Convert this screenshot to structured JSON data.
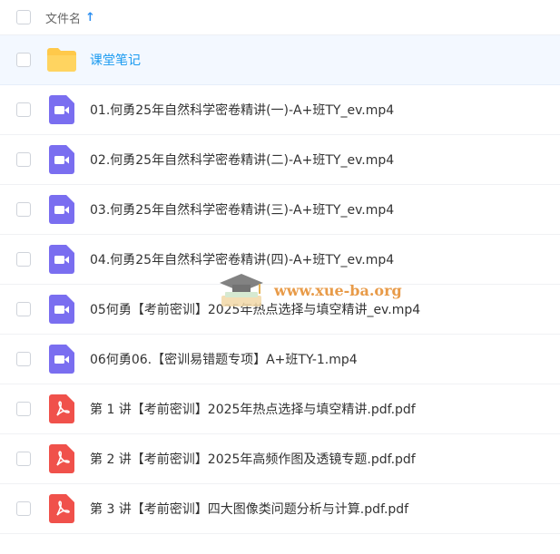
{
  "header": {
    "column_title": "文件名",
    "sort_icon": "arrow-up-icon"
  },
  "colors": {
    "accent": "#1a9af0",
    "video_icon": "#7a6ef0",
    "pdf_icon": "#f0514b",
    "folder_icon": "#ffc94a"
  },
  "files": [
    {
      "type": "folder",
      "icon": "folder-icon",
      "name": "课堂笔记"
    },
    {
      "type": "video",
      "icon": "video-icon",
      "name": "01.何勇25年自然科学密卷精讲(一)-A+班TY_ev.mp4"
    },
    {
      "type": "video",
      "icon": "video-icon",
      "name": "02.何勇25年自然科学密卷精讲(二)-A+班TY_ev.mp4"
    },
    {
      "type": "video",
      "icon": "video-icon",
      "name": "03.何勇25年自然科学密卷精讲(三)-A+班TY_ev.mp4"
    },
    {
      "type": "video",
      "icon": "video-icon",
      "name": "04.何勇25年自然科学密卷精讲(四)-A+班TY_ev.mp4"
    },
    {
      "type": "video",
      "icon": "video-icon",
      "name": "05何勇【考前密训】2025年热点选择与填空精讲_ev.mp4"
    },
    {
      "type": "video",
      "icon": "video-icon",
      "name": "06何勇06.【密训易错题专项】A+班TY-1.mp4"
    },
    {
      "type": "pdf",
      "icon": "pdf-icon",
      "name": "第 1 讲【考前密训】2025年热点选择与填空精讲.pdf.pdf"
    },
    {
      "type": "pdf",
      "icon": "pdf-icon",
      "name": "第 2 讲【考前密训】2025年高频作图及透镜专题.pdf.pdf"
    },
    {
      "type": "pdf",
      "icon": "pdf-icon",
      "name": "第 3 讲【考前密训】四大图像类问题分析与计算.pdf.pdf"
    }
  ],
  "watermark": {
    "text": "www.xue-ba.org",
    "icon": "graduation-cap-icon"
  }
}
